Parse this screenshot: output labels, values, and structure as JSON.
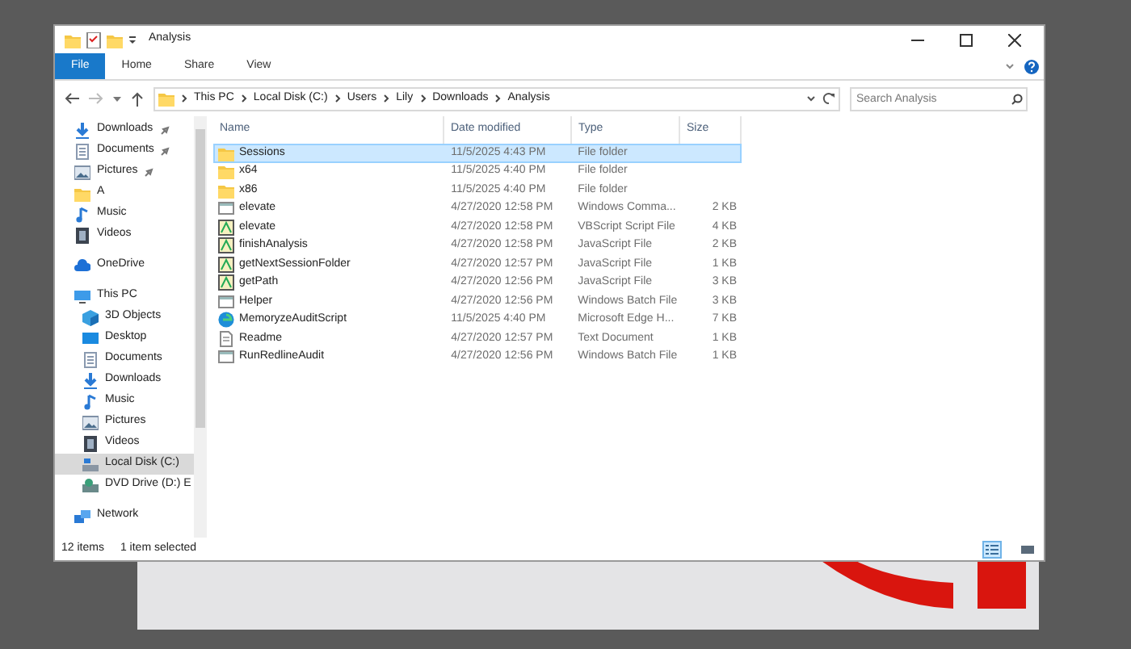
{
  "window": {
    "title": "Analysis",
    "quick_access_toolbar": [
      {
        "kind": "folder"
      },
      {
        "kind": "properties"
      },
      {
        "kind": "folder"
      }
    ]
  },
  "ribbon": {
    "tabs": [
      {
        "label": "File",
        "selected": true
      },
      {
        "label": "Home",
        "selected": false
      },
      {
        "label": "Share",
        "selected": false
      },
      {
        "label": "View",
        "selected": false
      }
    ]
  },
  "address_bar": {
    "path": [
      "This PC",
      "Local Disk (C:)",
      "Users",
      "Lily",
      "Downloads",
      "Analysis"
    ]
  },
  "search": {
    "placeholder": "Search Analysis"
  },
  "sidebar": {
    "sections": [
      {
        "items": [
          {
            "label": "Downloads",
            "kind": "download",
            "pinned": true,
            "selected": false
          },
          {
            "label": "Documents",
            "kind": "document",
            "pinned": true,
            "selected": false
          },
          {
            "label": "Pictures",
            "kind": "picture",
            "pinned": true,
            "selected": false
          },
          {
            "label": "A",
            "kind": "folder",
            "pinned": false,
            "selected": false
          },
          {
            "label": "Music",
            "kind": "music",
            "pinned": false,
            "selected": false
          },
          {
            "label": "Videos",
            "kind": "video",
            "pinned": false,
            "selected": false
          }
        ]
      },
      {
        "items": [
          {
            "label": "OneDrive",
            "kind": "cloud",
            "selected": false
          }
        ]
      },
      {
        "items": [
          {
            "label": "This PC",
            "kind": "pc",
            "selected": false,
            "children": [
              {
                "label": "3D Objects",
                "kind": "cube",
                "selected": false
              },
              {
                "label": "Desktop",
                "kind": "desktop",
                "selected": false
              },
              {
                "label": "Documents",
                "kind": "document",
                "selected": false
              },
              {
                "label": "Downloads",
                "kind": "download",
                "selected": false
              },
              {
                "label": "Music",
                "kind": "music",
                "selected": false
              },
              {
                "label": "Pictures",
                "kind": "picture",
                "selected": false
              },
              {
                "label": "Videos",
                "kind": "video",
                "selected": false
              },
              {
                "label": "Local Disk (C:)",
                "kind": "disk",
                "selected": true
              },
              {
                "label": "DVD Drive (D:) E",
                "kind": "dvd",
                "selected": false
              }
            ]
          }
        ]
      },
      {
        "items": [
          {
            "label": "Network",
            "kind": "network",
            "selected": false
          }
        ]
      }
    ]
  },
  "table": {
    "columns": [
      "Name",
      "Date modified",
      "Type",
      "Size"
    ],
    "rows": [
      {
        "name": "Sessions",
        "date": "11/5/2025 4:43 PM",
        "type": "File folder",
        "size": "",
        "kind": "folder",
        "selected": true
      },
      {
        "name": "x64",
        "date": "11/5/2025 4:40 PM",
        "type": "File folder",
        "size": "",
        "kind": "folder",
        "selected": false
      },
      {
        "name": "x86",
        "date": "11/5/2025 4:40 PM",
        "type": "File folder",
        "size": "",
        "kind": "folder",
        "selected": false
      },
      {
        "name": "elevate",
        "date": "4/27/2020 12:58 PM",
        "type": "Windows Comma...",
        "size": "2 KB",
        "kind": "cmd",
        "selected": false
      },
      {
        "name": "elevate",
        "date": "4/27/2020 12:58 PM",
        "type": "VBScript Script File",
        "size": "4 KB",
        "kind": "script",
        "selected": false
      },
      {
        "name": "finishAnalysis",
        "date": "4/27/2020 12:58 PM",
        "type": "JavaScript File",
        "size": "2 KB",
        "kind": "script",
        "selected": false
      },
      {
        "name": "getNextSessionFolder",
        "date": "4/27/2020 12:57 PM",
        "type": "JavaScript File",
        "size": "1 KB",
        "kind": "script",
        "selected": false
      },
      {
        "name": "getPath",
        "date": "4/27/2020 12:56 PM",
        "type": "JavaScript File",
        "size": "3 KB",
        "kind": "script",
        "selected": false
      },
      {
        "name": "Helper",
        "date": "4/27/2020 12:56 PM",
        "type": "Windows Batch File",
        "size": "3 KB",
        "kind": "cmd",
        "selected": false
      },
      {
        "name": "MemoryzeAuditScript",
        "date": "11/5/2025 4:40 PM",
        "type": "Microsoft Edge H...",
        "size": "7 KB",
        "kind": "edge",
        "selected": false
      },
      {
        "name": "Readme",
        "date": "4/27/2020 12:57 PM",
        "type": "Text Document",
        "size": "1 KB",
        "kind": "text",
        "selected": false
      },
      {
        "name": "RunRedlineAudit",
        "date": "4/27/2020 12:56 PM",
        "type": "Windows Batch File",
        "size": "1 KB",
        "kind": "cmd",
        "selected": false
      }
    ]
  },
  "status_bar": {
    "item_count": "12 items",
    "selection": "1 item selected"
  },
  "view_buttons": [
    {
      "kind": "details",
      "selected": true
    },
    {
      "kind": "thumbnails",
      "selected": false
    }
  ]
}
